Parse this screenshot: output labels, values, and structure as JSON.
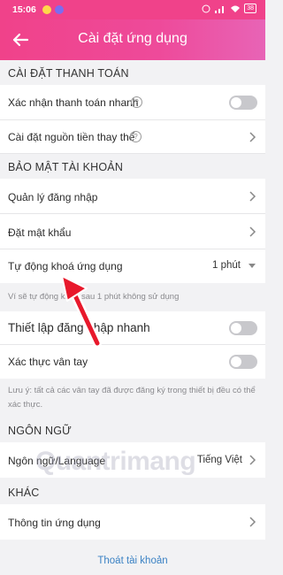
{
  "status_bar": {
    "time": "15:06",
    "battery": "38"
  },
  "header": {
    "title": "Cài đặt ứng dụng",
    "back_icon": "arrow-left-icon"
  },
  "sections": {
    "payment": "CÀI ĐẶT THANH TOÁN",
    "security": "BẢO MẬT TÀI KHOẢN",
    "language": "NGÔN NGỮ",
    "other": "KHÁC"
  },
  "rows": {
    "quick_pay": "Xác nhận thanh toán nhanh",
    "alt_funding": "Cài đặt nguồn tiền thay thế",
    "login_mgmt": "Quản lý đăng nhập",
    "set_password": "Đặt mật khẩu",
    "auto_lock": "Tự động khoá ứng dụng",
    "auto_lock_value": "1 phút",
    "quick_login": "Thiết lập đăng nhập nhanh",
    "fingerprint": "Xác thực vân tay",
    "language": "Ngôn ngữ/Language",
    "language_value": "Tiếng Việt",
    "app_info": "Thông tin ứng dụng"
  },
  "notes": {
    "auto_lock_note": "Ví sẽ tự động khoá sau 1 phút không sử dụng",
    "fingerprint_note": "Lưu ý: tất cả các vân tay đã được đăng ký trong thiết bị đều có thể xác thực."
  },
  "footer": {
    "logout": "Thoát tài khoản"
  },
  "watermark": "Quantrimang",
  "colors": {
    "header": "#f0428a",
    "link": "#3b82c4",
    "arrow": "#e8192c"
  }
}
